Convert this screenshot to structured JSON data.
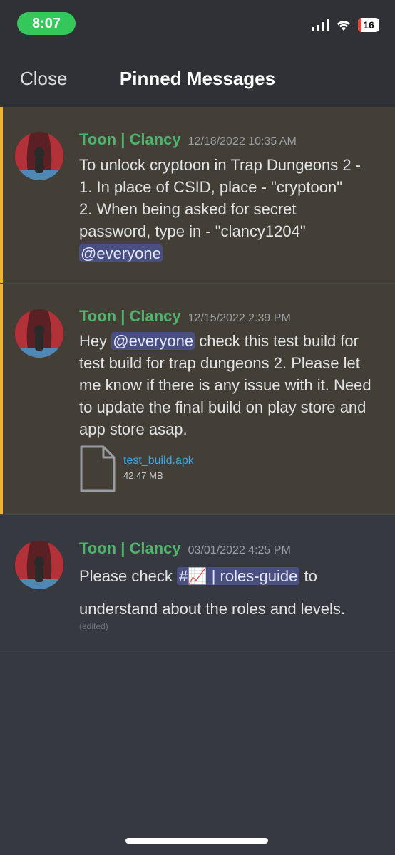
{
  "status_bar": {
    "time": "8:07",
    "battery": "16",
    "signal_icon": "cellular-signal-icon",
    "wifi_icon": "wifi-icon",
    "battery_icon": "battery-icon",
    "battery_color": "#e5443b"
  },
  "header": {
    "close_label": "Close",
    "title": "Pinned Messages"
  },
  "colors": {
    "author": "#4fb36d",
    "highlight_bar": "#f0b232",
    "mention_bg": "#4a4f82",
    "link": "#3ea6e0"
  },
  "messages": [
    {
      "author": "Toon | Clancy",
      "timestamp": "12/18/2022 10:35 AM",
      "lines": [
        "To unlock cryptoon in Trap Dungeons 2 -",
        "1. In place of CSID, place - \"cryptoon\"",
        "2. When being asked for secret",
        "password, type in - \"clancy1204\""
      ],
      "mention": "@everyone",
      "highlighted": true
    },
    {
      "author": "Toon | Clancy",
      "timestamp": "12/15/2022 2:39 PM",
      "text_before": "Hey ",
      "mention": "@everyone",
      "text_after": " check this test build for test build for trap dungeons 2. Please let me know if there is any issue with it. Need to update the final build on play store and app store asap.",
      "attachment": {
        "icon": "file-icon",
        "name": "test_build.apk",
        "size": "42.47 MB"
      },
      "highlighted": true
    },
    {
      "author": "Toon | Clancy",
      "timestamp": "03/01/2022 4:25 PM",
      "text_before": "Please check ",
      "channel": "#📈 | roles-guide",
      "text_after": " to",
      "line2": "understand about the roles and levels.",
      "edited": "(edited)",
      "highlighted": false
    }
  ]
}
